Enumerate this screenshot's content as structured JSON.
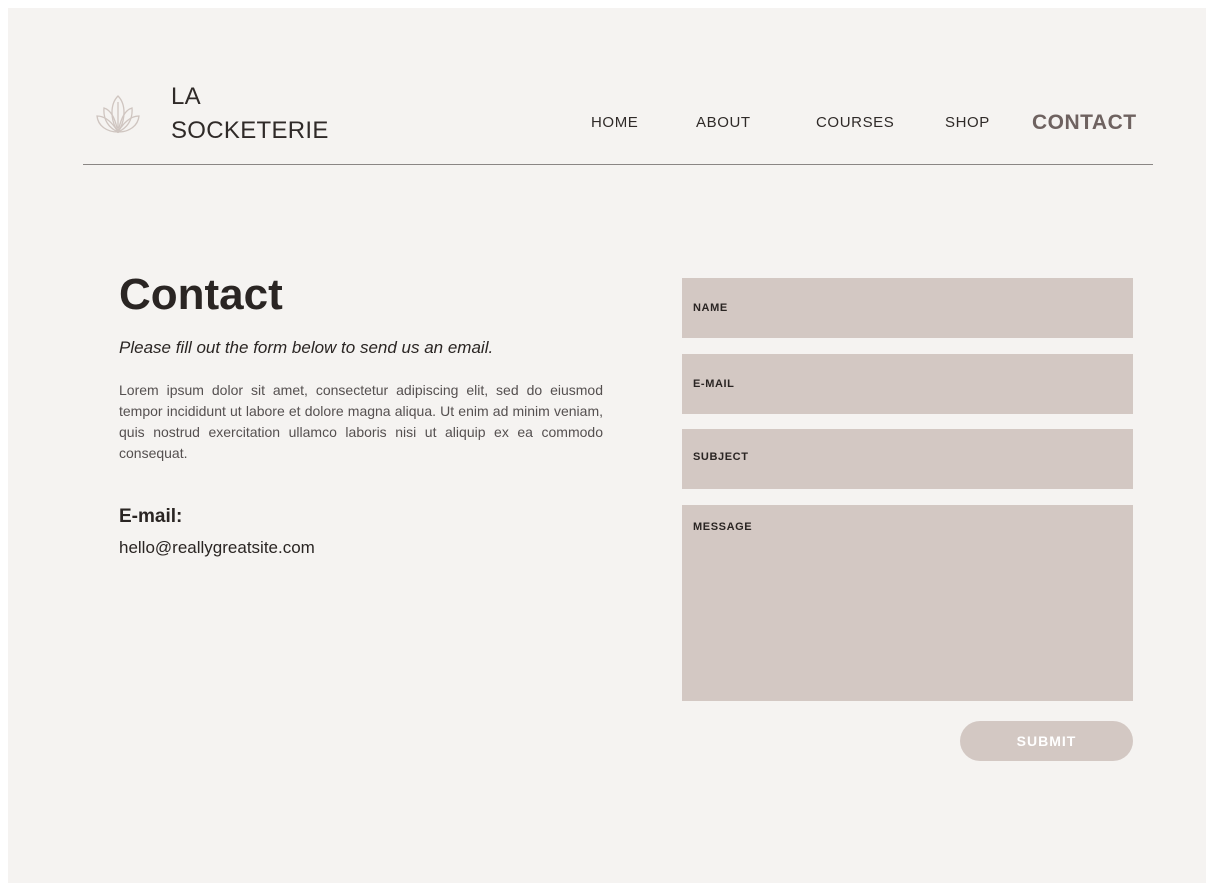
{
  "header": {
    "brand_line1": "LA",
    "brand_line2": "SOCKETERIE",
    "logo_icon": "lotus-icon",
    "nav": [
      {
        "label": "HOME"
      },
      {
        "label": "ABOUT"
      },
      {
        "label": "COURSES"
      },
      {
        "label": "SHOP"
      },
      {
        "label": "CONTACT",
        "active": true
      }
    ]
  },
  "contact": {
    "title": "Contact",
    "subtitle": "Please fill out the form below to send us an email.",
    "body": "Lorem ipsum dolor sit amet, consectetur adipiscing elit, sed do eiusmod tempor incididunt ut labore et dolore magna aliqua. Ut enim ad minim veniam, quis nostrud exercitation ullamco laboris nisi ut aliquip ex ea commodo consequat.",
    "email_label": "E-mail:",
    "email_value": "hello@reallygreatsite.com"
  },
  "form": {
    "name_label": "NAME",
    "email_label": "E-MAIL",
    "subject_label": "SUBJECT",
    "message_label": "MESSAGE",
    "submit_label": "SUBMIT"
  },
  "colors": {
    "page_bg": "#f5f3f1",
    "field_bg": "#d3c8c3",
    "text_dark": "#2a2523",
    "nav_active": "#6e6260"
  }
}
